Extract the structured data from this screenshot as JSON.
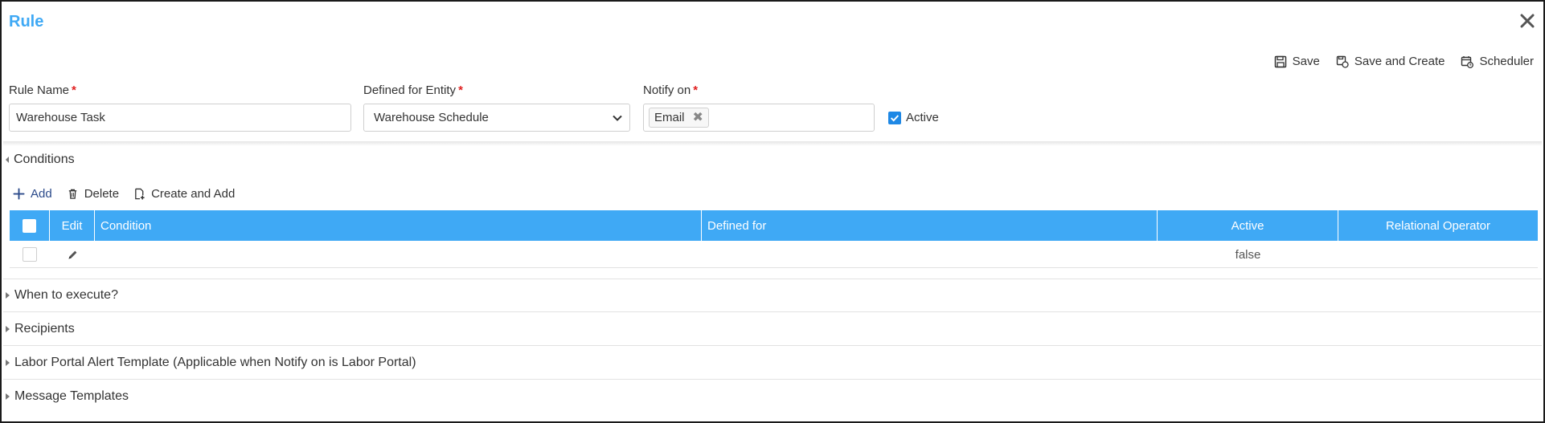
{
  "dialog": {
    "title": "Rule",
    "close_icon": "close-icon"
  },
  "toolbar": {
    "save_label": "Save",
    "save_and_create_label": "Save and Create",
    "scheduler_label": "Scheduler"
  },
  "form": {
    "rule_name": {
      "label": "Rule Name",
      "required_mark": "*",
      "value": "Warehouse Task"
    },
    "defined_for_entity": {
      "label": "Defined for Entity",
      "required_mark": "*",
      "value": "Warehouse Schedule"
    },
    "notify_on": {
      "label": "Notify on",
      "required_mark": "*",
      "chips": [
        "Email"
      ]
    },
    "active": {
      "label": "Active",
      "checked": true
    }
  },
  "sections": {
    "conditions": "Conditions",
    "when_to_execute": "When to execute?",
    "recipients": "Recipients",
    "labor_portal": "Labor Portal Alert Template (Applicable when Notify on is Labor Portal)",
    "message_templates": "Message Templates"
  },
  "grid_toolbar": {
    "add_label": "Add",
    "delete_label": "Delete",
    "create_and_add_label": "Create and Add"
  },
  "grid": {
    "columns": [
      "Edit",
      "Condition",
      "Defined for",
      "Active",
      "Relational Operator"
    ],
    "rows": [
      {
        "condition": "",
        "defined_for": "",
        "active": "false",
        "relational_operator": ""
      }
    ]
  },
  "colors": {
    "accent": "#3fa9f5",
    "required": "#e02020",
    "checkbox": "#1e88e5"
  }
}
